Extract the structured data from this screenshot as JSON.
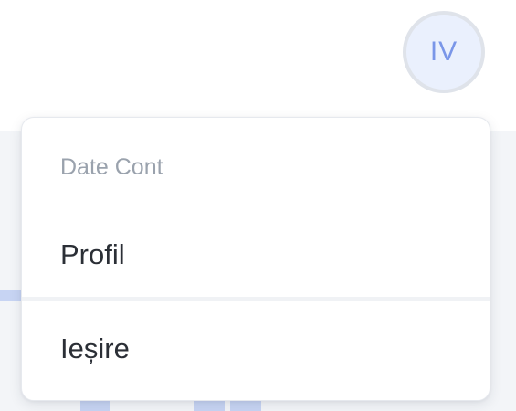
{
  "user": {
    "initials": "IV"
  },
  "dropdown": {
    "header": "Date Cont",
    "items": [
      {
        "label": "Profil"
      },
      {
        "label": "Ieșire"
      }
    ]
  },
  "colors": {
    "avatar_bg": "#eaf0fd",
    "avatar_text": "#7a96e8",
    "header_text": "#9aa2ad",
    "item_text": "#2b2f36"
  }
}
